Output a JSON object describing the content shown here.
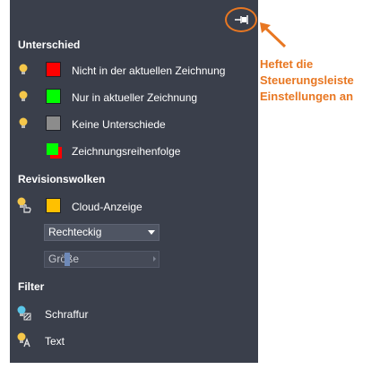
{
  "panel": {
    "sections": {
      "difference": {
        "heading": "Unterschied"
      },
      "revision_clouds": {
        "heading": "Revisionswolken"
      },
      "filter": {
        "heading": "Filter"
      }
    },
    "rows": {
      "not_in_current": {
        "label": "Nicht in der aktuellen Zeichnung",
        "color": "#ff0000",
        "icon": "lightbulb-icon"
      },
      "only_in_current": {
        "label": "Nur in aktueller Zeichnung",
        "color": "#00ff00",
        "icon": "lightbulb-icon"
      },
      "no_differences": {
        "label": "Keine Unterschiede",
        "color": "#8c8c8c",
        "icon": "lightbulb-icon"
      },
      "draw_order": {
        "label": "Zeichnungsreihenfolge",
        "colors": [
          "#00ff00",
          "#ff0000"
        ]
      },
      "cloud_display": {
        "label": "Cloud-Anzeige",
        "color": "#ffc000",
        "icon": "lightbulb-hand-icon"
      },
      "hatch": {
        "label": "Schraffur",
        "icon": "lightbulb-hatch-icon"
      },
      "text": {
        "label": "Text",
        "icon": "lightbulb-text-icon"
      }
    },
    "cloud_shape": {
      "selected": "Rechteckig"
    },
    "cloud_size": {
      "label": "Größe"
    },
    "pin_icon": "pin-icon"
  },
  "callout": {
    "text": "Heftet die\nSteuerungsleiste\nEinstellungen an",
    "color": "#e87722"
  }
}
